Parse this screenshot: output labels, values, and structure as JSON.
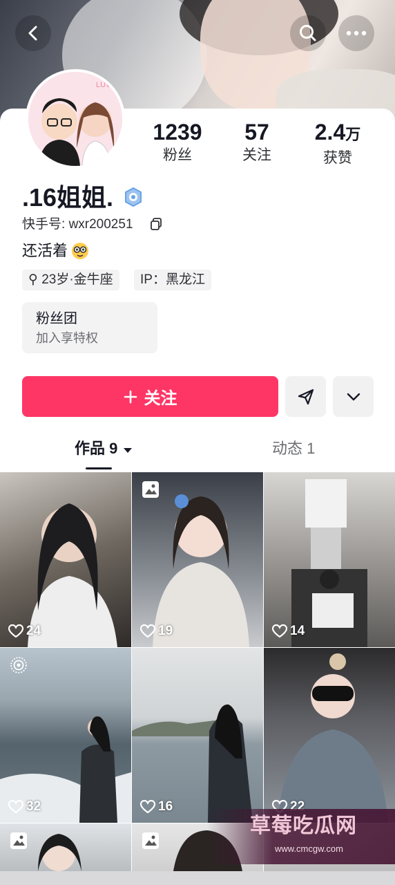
{
  "header": {
    "back_icon": "chevron-left-icon",
    "search_icon": "search-icon",
    "more_icon": "more-horizontal-icon"
  },
  "profile": {
    "name": ".16姐姐.",
    "kuaishou_id_label": "快手号:",
    "kuaishou_id": "wxr200251",
    "bio": "还活着",
    "tags": [
      "⚲ 23岁·金牛座",
      "IP：黑龙江"
    ],
    "avatar_badge_text": "LUV"
  },
  "stats": [
    {
      "value": "1239",
      "label": "粉丝"
    },
    {
      "value": "57",
      "label": "关注"
    },
    {
      "value": "2.4",
      "unit": "万",
      "label": "获赞"
    }
  ],
  "fans_club": {
    "title": "粉丝团",
    "subtitle": "加入享特权"
  },
  "actions": {
    "follow_label": "关注",
    "accent_color": "#fe3666"
  },
  "tabs": {
    "works": "作品 9",
    "moments": "动态 1"
  },
  "posts": [
    {
      "likes": "24",
      "badge": ""
    },
    {
      "likes": "19",
      "badge": "image-icon"
    },
    {
      "likes": "14",
      "badge": ""
    },
    {
      "likes": "32",
      "badge": "live-photo-icon"
    },
    {
      "likes": "16",
      "badge": ""
    },
    {
      "likes": "22",
      "badge": ""
    },
    {
      "likes": "",
      "badge": "image-icon"
    },
    {
      "likes": "",
      "badge": "image-icon"
    },
    {
      "likes": "",
      "badge": ""
    }
  ],
  "watermark": {
    "title": "草莓吃瓜网",
    "url": "www.cmcgw.com"
  }
}
